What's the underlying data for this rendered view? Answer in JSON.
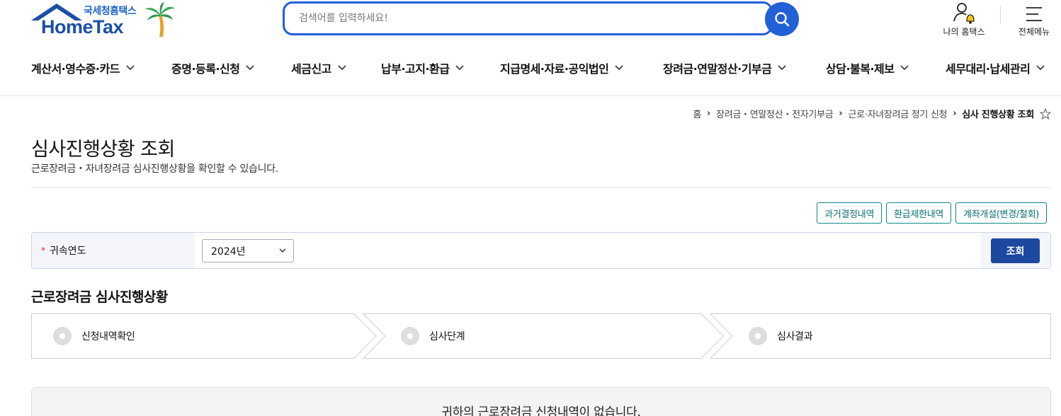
{
  "header": {
    "logo_sub": "국세청홈택스",
    "logo_main": "HomeTax",
    "search_placeholder": "검색어를 입력하세요!",
    "my_hometax": "나의 홈택스",
    "all_menu": "전체메뉴"
  },
  "gnb": [
    "계산서·영수증·카드",
    "증명·등록·신청",
    "세금신고",
    "납부·고지·환급",
    "지급명세·자료·공익법인",
    "장려금·연말정산·기부금",
    "상담·불복·제보",
    "세무대리·납세관리"
  ],
  "breadcrumb": {
    "items": [
      "홈",
      "장려금・연말정산・전자기부금",
      "근로·자녀장려금 정기 신청"
    ],
    "current": "심사 진행상황 조회"
  },
  "page": {
    "title": "심사진행상황 조회",
    "desc": "근로장려금・자녀장려금 심사진행상황을 확인할 수 있습니다."
  },
  "top_buttons": [
    "과거결정내역",
    "환급제한내역",
    "계좌개설(변경/철회)"
  ],
  "filter": {
    "required_mark": "*",
    "label": "귀속연도",
    "year_value": "2024년",
    "query_button": "조회"
  },
  "section_title": "근로장려금 심사진행상황",
  "steps": [
    "신청내역확인",
    "심사단계",
    "심사결과"
  ],
  "result_message": "귀하의 근로장려금 신청내역이 없습니다.",
  "colors": {
    "brand_blue": "#2160d6",
    "navy": "#1d48a0",
    "teal": "#0b8a8a",
    "required_red": "#d8262d"
  }
}
